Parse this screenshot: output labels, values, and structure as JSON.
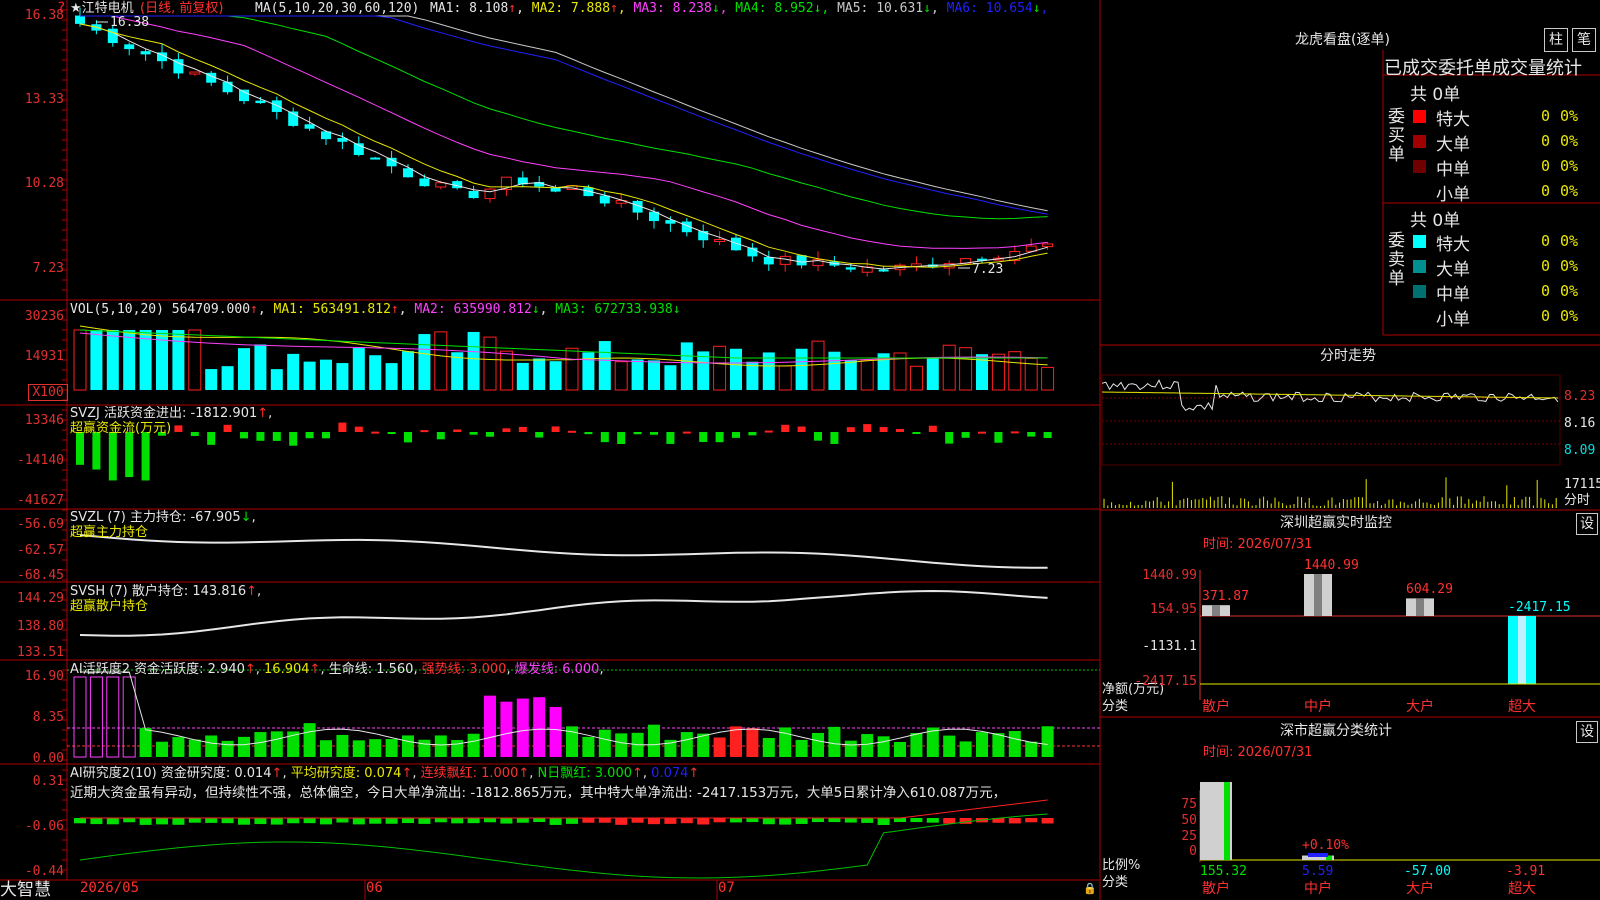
{
  "stock": {
    "star": "★",
    "name": "江特电机",
    "mode": "(日线, 前复权)",
    "ma_label": "MA(5,10,20,30,60,120)",
    "high_mark": "16.38",
    "low_mark": "7.23"
  },
  "ma_legend": [
    {
      "label": "MA1: 8.108",
      "arrow": "↑",
      "color": "#e6e6e6"
    },
    {
      "label": "MA2: 7.888",
      "arrow": "↑",
      "color": "#e8e800"
    },
    {
      "label": "MA3: 8.238",
      "arrow": "↓",
      "color": "#ff40ff"
    },
    {
      "label": "MA4: 8.952",
      "arrow": "↓",
      "color": "#00e000"
    },
    {
      "label": "MA5: 10.631",
      "arrow": "↓",
      "color": "#c8c8c8"
    },
    {
      "label": "MA6: 10.654",
      "arrow": "↓",
      "color": "#2020ff"
    }
  ],
  "price_axis": [
    "16.38",
    "13.33",
    "10.28",
    "7.23"
  ],
  "vol": {
    "title": "VOL(5,10,20)",
    "value": "564709.000",
    "ma1": "MA1: 563491.812",
    "ma2": "MA2: 635990.812",
    "ma3": "MA3: 672733.938",
    "axis": [
      "30236",
      "14931",
      "X100"
    ]
  },
  "svzj": {
    "title": "SVZJ  活跃资金进出: -1812.901",
    "sub": "超赢资金流(万元)",
    "axis": [
      "13346",
      "-14140",
      "-41627"
    ]
  },
  "svzl": {
    "title": "SVZL (7) 主力持仓: -67.905",
    "sub": "超赢主力持仓",
    "axis": [
      "-56.69",
      "-62.57",
      "-68.45"
    ]
  },
  "svsh": {
    "title": "SVSH (7) 散户持仓: 143.816",
    "sub": "超赢散户持仓",
    "axis": [
      "144.29",
      "138.80",
      "133.51"
    ]
  },
  "ai1": {
    "title": "AI活跃度2 资金活跃度: 2.940",
    "v2": "16.904",
    "life": "生命线: 1.560",
    "strong": "强势线: 3.000",
    "burst": "爆发线: 6.000",
    "axis": [
      "16.90",
      "8.35",
      "0.00"
    ]
  },
  "ai2": {
    "title": "AI研究度2(10) 资金研究度: 0.014",
    "avg": "平均研究度: 0.074",
    "red": "连续飘红: 1.000",
    "nred": "N日飘红: 3.000",
    "last": "0.074",
    "axis": [
      "0.31",
      "-0.06",
      "-0.44"
    ],
    "comment": "近期大资金虽有异动，但持续性不强，总体偏空，今日大单净流出: -1812.865万元，其中特大单净流出: -2417.153万元，大单5日累计净入610.087万元，"
  },
  "bottom": {
    "brand": "大智慧",
    "dates": [
      "2026/05",
      "06",
      "07"
    ]
  },
  "dragon": {
    "title": "龙虎看盘(逐单)",
    "btn1": "柱",
    "btn2": "笔",
    "header": "已成交委托单成交量统计",
    "buy_label": "委买单",
    "sell_label": "委卖单",
    "buy_total": "共 0单",
    "sell_total": "共 0单",
    "buy": [
      {
        "name": "特大",
        "c": "#ff0000",
        "n": "0",
        "p": "0%"
      },
      {
        "name": "大单",
        "c": "#a00000",
        "n": "0",
        "p": "0%"
      },
      {
        "name": "中单",
        "c": "#700000",
        "n": "0",
        "p": "0%"
      },
      {
        "name": "小单",
        "c": "",
        "n": "0",
        "p": "0%"
      }
    ],
    "sell": [
      {
        "name": "特大",
        "c": "#00ffff",
        "n": "0",
        "p": "0%"
      },
      {
        "name": "大单",
        "c": "#009090",
        "n": "0",
        "p": "0%"
      },
      {
        "name": "中单",
        "c": "#007070",
        "n": "0",
        "p": "0%"
      },
      {
        "name": "小单",
        "c": "",
        "n": "0",
        "p": "0%"
      }
    ]
  },
  "intraday": {
    "title": "分时走势",
    "axis": [
      "8.23",
      "8.16",
      "8.09"
    ],
    "vol": "17115",
    "unit": "分时"
  },
  "monitor": {
    "title": "深圳超赢实时监控",
    "btn": "设",
    "time": "时间: 2026/07/31",
    "axis": [
      "1440.99",
      "154.95",
      "-1131.1",
      "-2417.15"
    ],
    "unit": "净额(万元)",
    "cat": "分类",
    "bars": [
      {
        "name": "散户",
        "value": 371.87,
        "label": "371.87"
      },
      {
        "name": "中户",
        "value": 1440.99,
        "label": "1440.99"
      },
      {
        "name": "大户",
        "value": 604.29,
        "label": "604.29"
      },
      {
        "name": "超大",
        "value": -2417.15,
        "label": "-2417.15"
      }
    ]
  },
  "classify": {
    "title": "深市超赢分类统计",
    "btn": "设",
    "time": "时间: 2026/07/31",
    "axis": [
      "75",
      "50",
      "25",
      "0"
    ],
    "unit": "比例%",
    "cat": "分类",
    "bars": [
      {
        "name": "散户",
        "value": 155.32,
        "label": "155.32",
        "top": ""
      },
      {
        "name": "中户",
        "value": 5.59,
        "label": "5.59",
        "top": "+0.10%"
      },
      {
        "name": "大户",
        "value": -57.0,
        "label": "-57.00",
        "top": ""
      },
      {
        "name": "超大",
        "value": -3.91,
        "label": "-3.91",
        "top": ""
      }
    ]
  },
  "chart_data": [
    {
      "type": "candlestick",
      "title": "江特电机(日线, 前复权)",
      "ylim": [
        7.23,
        16.38
      ],
      "x": [
        "2026/05",
        "06",
        "07"
      ],
      "series": [
        {
          "name": "MA1",
          "values": [
            8.108
          ]
        },
        {
          "name": "MA2",
          "values": [
            7.888
          ]
        },
        {
          "name": "MA3",
          "values": [
            8.238
          ]
        },
        {
          "name": "MA4",
          "values": [
            8.952
          ]
        },
        {
          "name": "MA5",
          "values": [
            10.631
          ]
        },
        {
          "name": "MA6",
          "values": [
            10.654
          ]
        }
      ]
    },
    {
      "type": "bar",
      "title": "超赢实时监控",
      "categories": [
        "散户",
        "中户",
        "大户",
        "超大"
      ],
      "values": [
        371.87,
        1440.99,
        604.29,
        -2417.15
      ],
      "ylabel": "净额(万元)",
      "ylim": [
        -2417.15,
        1440.99
      ]
    },
    {
      "type": "bar",
      "title": "超赢分类统计",
      "categories": [
        "散户",
        "中户",
        "大户",
        "超大"
      ],
      "values": [
        155.32,
        5.59,
        -57.0,
        -3.91
      ],
      "ylabel": "比例%",
      "ylim": [
        0,
        75
      ]
    }
  ]
}
